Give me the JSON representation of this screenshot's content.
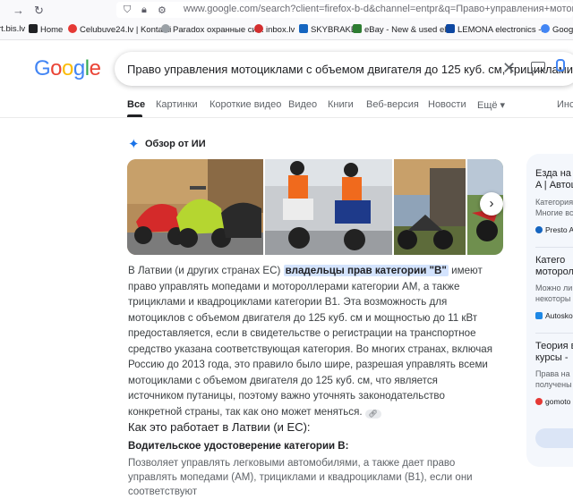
{
  "browser": {
    "url": "www.google.com/search?client=firefox-b-d&channel=entpr&q=Право+управления+мотоциклами+с+об",
    "bookmarks": [
      "rt.bis.lv",
      "Home",
      "Celubuve24.lv | Kontakti",
      "Paradox охранные си...",
      "inbox.lv",
      "SKYBRAKE",
      "eBay - New & used el...",
      "LEMONA electronics -...",
      "Googl"
    ]
  },
  "logo": {
    "g1": "G",
    "o1": "o",
    "o2": "o",
    "g2": "g",
    "l": "l",
    "e": "e"
  },
  "search": {
    "query": "Право управления мотоциклами с объемом двигателя до 125 куб. см, трициклами"
  },
  "tabs": [
    "Все",
    "Картинки",
    "Короткие видео",
    "Видео",
    "Книги",
    "Веб-версия",
    "Новости",
    "Ещё ▾",
    "Инс"
  ],
  "ai": {
    "title": "Обзор от ИИ",
    "p1_pre": "В Латвии (и других странах ЕС)",
    "p1_hl": "владельцы прав категории \"B\"",
    "p1_post": "имеют право управлять мопедами и мотороллерами категории AM, а также трициклами и квадроциклами категории B1. Эта возможность для мотоциклов с объемом двигателя до 125 куб. см и мощностью до 11 кВт предоставляется, если в свидетельстве о регистрации на транспортное средство указана соответствующая категория. Во многих странах, включая Россию до 2013 года, это правило было шире, разрешая управлять всеми мотоциклами с объемом двигателя до 125 куб. см, что является источником путаницы, поэтому важно уточнять законодательство конкретной страны, так как оно может меняться.",
    "section_heading": "Как это работает в Латвии (и ЕС):",
    "sub_heading": "Водительское удостоверение категории B:",
    "sub_body": "Позволяет управлять легковыми автомобилями, а также дает право управлять мопедами (AM), трициклами и квадроциклами (B1), если они соответствуют"
  },
  "sources": [
    {
      "title1": "Езда на",
      "title2": "A | Автош",
      "snip1": "Категория",
      "snip2": "Многие вс",
      "site": "Presto A"
    },
    {
      "title1": "Катего",
      "title2": "моторол",
      "snip1": "Можно ли",
      "snip2": "некоторы",
      "site": "Autoskol"
    },
    {
      "title1": "Теория в",
      "title2": "курсы -",
      "snip1": "Права на",
      "snip2": "получены",
      "site": "gomoto"
    }
  ],
  "colors": {
    "accent": "#1a73e8",
    "highlight": "#d3e3fd"
  }
}
